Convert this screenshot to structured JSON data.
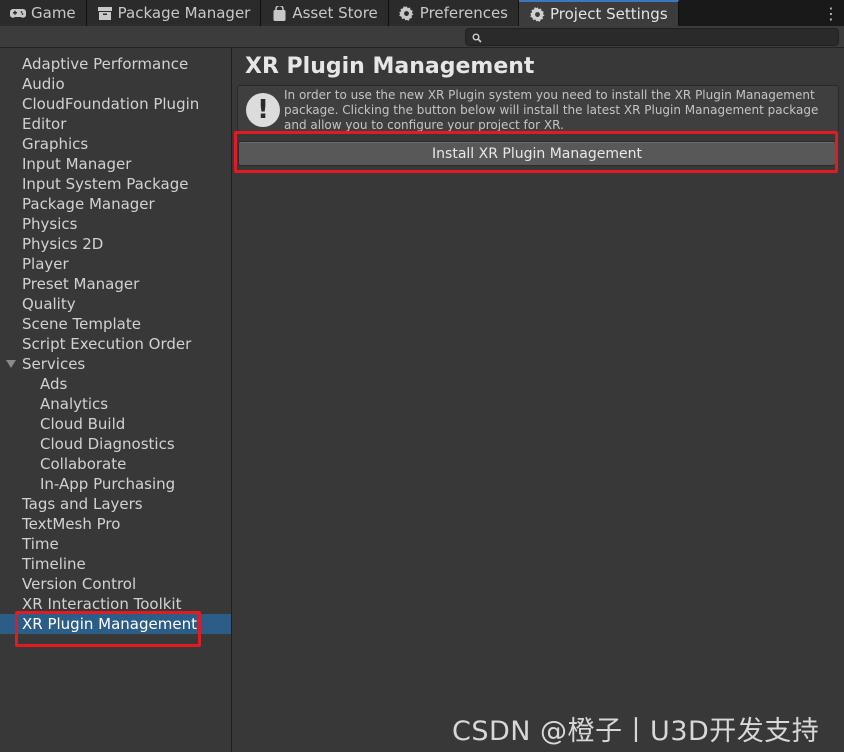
{
  "tabs": [
    {
      "label": "Game",
      "icon": "gamepad-icon",
      "active": false
    },
    {
      "label": "Package Manager",
      "icon": "package-icon",
      "active": false
    },
    {
      "label": "Asset Store",
      "icon": "bag-icon",
      "active": false
    },
    {
      "label": "Preferences",
      "icon": "gear-icon",
      "active": false
    },
    {
      "label": "Project Settings",
      "icon": "gear-icon",
      "active": true
    }
  ],
  "menu": {
    "kebab": "⋮"
  },
  "search": {
    "placeholder": "",
    "value": ""
  },
  "sidebar": {
    "items": [
      {
        "label": "Adaptive Performance"
      },
      {
        "label": "Audio"
      },
      {
        "label": "CloudFoundation Plugin"
      },
      {
        "label": "Editor"
      },
      {
        "label": "Graphics"
      },
      {
        "label": "Input Manager"
      },
      {
        "label": "Input System Package"
      },
      {
        "label": "Package Manager"
      },
      {
        "label": "Physics"
      },
      {
        "label": "Physics 2D"
      },
      {
        "label": "Player"
      },
      {
        "label": "Preset Manager"
      },
      {
        "label": "Quality"
      },
      {
        "label": "Scene Template"
      },
      {
        "label": "Script Execution Order"
      },
      {
        "label": "Services"
      },
      {
        "label": "Ads"
      },
      {
        "label": "Analytics"
      },
      {
        "label": "Cloud Build"
      },
      {
        "label": "Cloud Diagnostics"
      },
      {
        "label": "Collaborate"
      },
      {
        "label": "In-App Purchasing"
      },
      {
        "label": "Tags and Layers"
      },
      {
        "label": "TextMesh Pro"
      },
      {
        "label": "Time"
      },
      {
        "label": "Timeline"
      },
      {
        "label": "Version Control"
      },
      {
        "label": "XR Interaction Toolkit"
      },
      {
        "label": "XR Plugin Management"
      }
    ]
  },
  "main": {
    "title": "XR Plugin Management",
    "help_text": "In order to use the new XR Plugin system you need to install the XR Plugin Management package. Clicking the button below will install the latest XR Plugin Management package and allow you to configure your project for XR.",
    "install_label": "Install XR Plugin Management"
  },
  "watermark": "CSDN @橙子丨U3D开发支持",
  "colors": {
    "selection": "#2c5d87",
    "highlight": "#e11b24",
    "active_tab_accent": "#3a79bb"
  }
}
